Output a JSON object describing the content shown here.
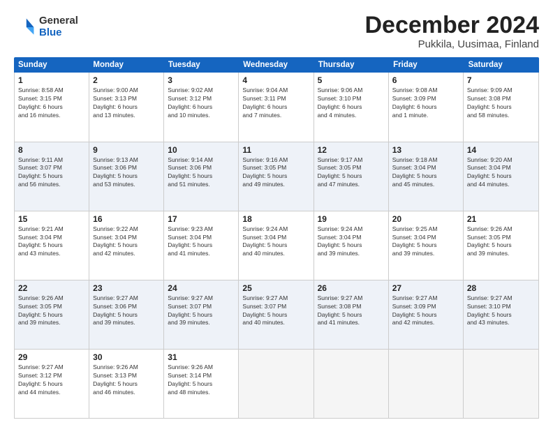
{
  "logo": {
    "general": "General",
    "blue": "Blue"
  },
  "title": "December 2024",
  "subtitle": "Pukkila, Uusimaa, Finland",
  "headers": [
    "Sunday",
    "Monday",
    "Tuesday",
    "Wednesday",
    "Thursday",
    "Friday",
    "Saturday"
  ],
  "weeks": [
    [
      {
        "day": "1",
        "info": "Sunrise: 8:58 AM\nSunset: 3:15 PM\nDaylight: 6 hours\nand 16 minutes."
      },
      {
        "day": "2",
        "info": "Sunrise: 9:00 AM\nSunset: 3:13 PM\nDaylight: 6 hours\nand 13 minutes."
      },
      {
        "day": "3",
        "info": "Sunrise: 9:02 AM\nSunset: 3:12 PM\nDaylight: 6 hours\nand 10 minutes."
      },
      {
        "day": "4",
        "info": "Sunrise: 9:04 AM\nSunset: 3:11 PM\nDaylight: 6 hours\nand 7 minutes."
      },
      {
        "day": "5",
        "info": "Sunrise: 9:06 AM\nSunset: 3:10 PM\nDaylight: 6 hours\nand 4 minutes."
      },
      {
        "day": "6",
        "info": "Sunrise: 9:08 AM\nSunset: 3:09 PM\nDaylight: 6 hours\nand 1 minute."
      },
      {
        "day": "7",
        "info": "Sunrise: 9:09 AM\nSunset: 3:08 PM\nDaylight: 5 hours\nand 58 minutes."
      }
    ],
    [
      {
        "day": "8",
        "info": "Sunrise: 9:11 AM\nSunset: 3:07 PM\nDaylight: 5 hours\nand 56 minutes."
      },
      {
        "day": "9",
        "info": "Sunrise: 9:13 AM\nSunset: 3:06 PM\nDaylight: 5 hours\nand 53 minutes."
      },
      {
        "day": "10",
        "info": "Sunrise: 9:14 AM\nSunset: 3:06 PM\nDaylight: 5 hours\nand 51 minutes."
      },
      {
        "day": "11",
        "info": "Sunrise: 9:16 AM\nSunset: 3:05 PM\nDaylight: 5 hours\nand 49 minutes."
      },
      {
        "day": "12",
        "info": "Sunrise: 9:17 AM\nSunset: 3:05 PM\nDaylight: 5 hours\nand 47 minutes."
      },
      {
        "day": "13",
        "info": "Sunrise: 9:18 AM\nSunset: 3:04 PM\nDaylight: 5 hours\nand 45 minutes."
      },
      {
        "day": "14",
        "info": "Sunrise: 9:20 AM\nSunset: 3:04 PM\nDaylight: 5 hours\nand 44 minutes."
      }
    ],
    [
      {
        "day": "15",
        "info": "Sunrise: 9:21 AM\nSunset: 3:04 PM\nDaylight: 5 hours\nand 43 minutes."
      },
      {
        "day": "16",
        "info": "Sunrise: 9:22 AM\nSunset: 3:04 PM\nDaylight: 5 hours\nand 42 minutes."
      },
      {
        "day": "17",
        "info": "Sunrise: 9:23 AM\nSunset: 3:04 PM\nDaylight: 5 hours\nand 41 minutes."
      },
      {
        "day": "18",
        "info": "Sunrise: 9:24 AM\nSunset: 3:04 PM\nDaylight: 5 hours\nand 40 minutes."
      },
      {
        "day": "19",
        "info": "Sunrise: 9:24 AM\nSunset: 3:04 PM\nDaylight: 5 hours\nand 39 minutes."
      },
      {
        "day": "20",
        "info": "Sunrise: 9:25 AM\nSunset: 3:04 PM\nDaylight: 5 hours\nand 39 minutes."
      },
      {
        "day": "21",
        "info": "Sunrise: 9:26 AM\nSunset: 3:05 PM\nDaylight: 5 hours\nand 39 minutes."
      }
    ],
    [
      {
        "day": "22",
        "info": "Sunrise: 9:26 AM\nSunset: 3:05 PM\nDaylight: 5 hours\nand 39 minutes."
      },
      {
        "day": "23",
        "info": "Sunrise: 9:27 AM\nSunset: 3:06 PM\nDaylight: 5 hours\nand 39 minutes."
      },
      {
        "day": "24",
        "info": "Sunrise: 9:27 AM\nSunset: 3:07 PM\nDaylight: 5 hours\nand 39 minutes."
      },
      {
        "day": "25",
        "info": "Sunrise: 9:27 AM\nSunset: 3:07 PM\nDaylight: 5 hours\nand 40 minutes."
      },
      {
        "day": "26",
        "info": "Sunrise: 9:27 AM\nSunset: 3:08 PM\nDaylight: 5 hours\nand 41 minutes."
      },
      {
        "day": "27",
        "info": "Sunrise: 9:27 AM\nSunset: 3:09 PM\nDaylight: 5 hours\nand 42 minutes."
      },
      {
        "day": "28",
        "info": "Sunrise: 9:27 AM\nSunset: 3:10 PM\nDaylight: 5 hours\nand 43 minutes."
      }
    ],
    [
      {
        "day": "29",
        "info": "Sunrise: 9:27 AM\nSunset: 3:12 PM\nDaylight: 5 hours\nand 44 minutes."
      },
      {
        "day": "30",
        "info": "Sunrise: 9:26 AM\nSunset: 3:13 PM\nDaylight: 5 hours\nand 46 minutes."
      },
      {
        "day": "31",
        "info": "Sunrise: 9:26 AM\nSunset: 3:14 PM\nDaylight: 5 hours\nand 48 minutes."
      },
      {
        "day": "",
        "info": ""
      },
      {
        "day": "",
        "info": ""
      },
      {
        "day": "",
        "info": ""
      },
      {
        "day": "",
        "info": ""
      }
    ]
  ]
}
